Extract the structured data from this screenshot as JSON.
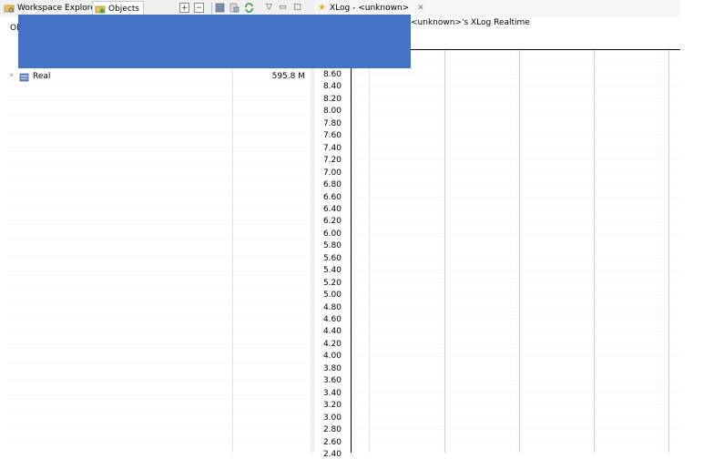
{
  "left_view": {
    "tabs": [
      {
        "label": "Workspace Explorer",
        "icon": "folder-explorer-icon",
        "active": false
      },
      {
        "label": "Objects",
        "icon": "objects-icon",
        "active": true
      }
    ],
    "toolbar": [
      {
        "icon": "expand-all-icon",
        "glyph": "+"
      },
      {
        "icon": "collapse-all-icon",
        "glyph": "−"
      },
      {
        "icon": "server-list-icon",
        "glyph": ""
      },
      {
        "icon": "export-icon",
        "glyph": ""
      },
      {
        "icon": "refresh-icon",
        "glyph": ""
      },
      {
        "icon": "view-menu-icon",
        "glyph": "▽"
      },
      {
        "icon": "minimize-icon",
        "glyph": "▭"
      },
      {
        "icon": "maximize-icon",
        "glyph": "□"
      }
    ],
    "header_label": "Ob",
    "rows": [
      {
        "name": "Real",
        "memory": "595.8 M",
        "icon": "server-icon"
      }
    ]
  },
  "right_view": {
    "tab": {
      "label": "XLog - <unknown>",
      "icon": "star-icon",
      "close_icon": "close-icon"
    },
    "chart_title": "<unknown>'s XLog Realtime"
  },
  "chart_data": {
    "type": "scatter",
    "title": "<unknown>'s XLog Realtime",
    "y_ticks": [
      "8.60",
      "8.40",
      "8.20",
      "8.00",
      "7.80",
      "7.60",
      "7.40",
      "7.20",
      "7.00",
      "6.80",
      "6.60",
      "6.40",
      "6.20",
      "6.00",
      "5.80",
      "5.60",
      "5.40",
      "5.20",
      "5.00",
      "4.80",
      "4.60",
      "4.40",
      "4.20",
      "4.00",
      "3.80",
      "3.60",
      "3.40",
      "3.20",
      "3.00",
      "2.80",
      "2.60",
      "2.40"
    ],
    "ylim": [
      2.4,
      8.6
    ],
    "series": [],
    "grid": true
  },
  "colors": {
    "overlay": "#4472c4",
    "grid_major": "#c9cdf2",
    "grid_minor": "#eef0f6"
  }
}
